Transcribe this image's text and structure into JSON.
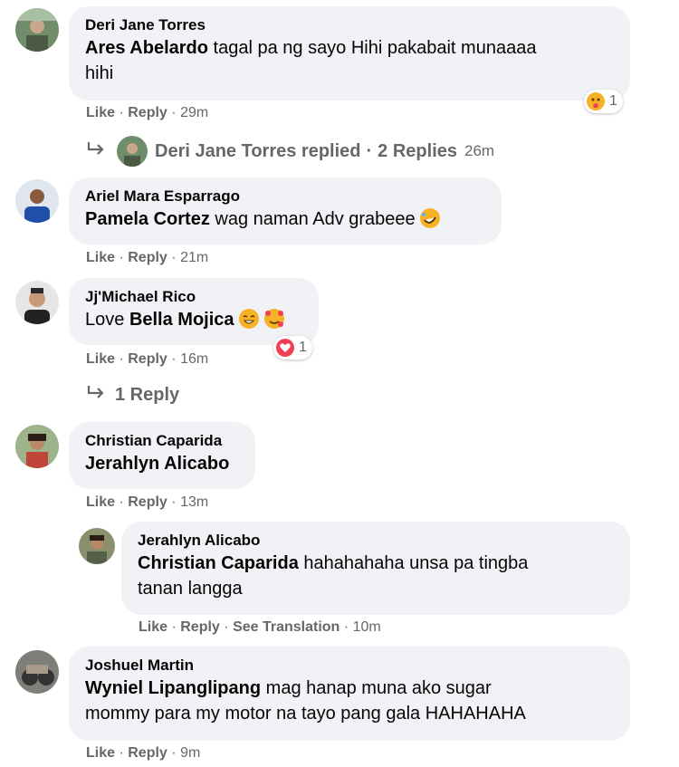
{
  "comments": [
    {
      "author": "Deri Jane Torres",
      "mention": "Ares Abelardo",
      "text_line1": "tagal pa ng sayo Hihi pakabait munaaaa",
      "text_line2": "hihi",
      "like": "Like",
      "reply": "Reply",
      "time": "29m",
      "reaction_icon": "care-icon",
      "reaction_count": "1",
      "replies_author": "Deri Jane Torres replied",
      "replies_count": "2 Replies",
      "replies_time": "26m"
    },
    {
      "author": "Ariel Mara Esparrago",
      "mention": "Pamela Cortez",
      "text": "wag naman Adv grabeee",
      "emoji": "rolling-laughing-emoji",
      "like": "Like",
      "reply": "Reply",
      "time": "21m"
    },
    {
      "author": "Jj'Michael Rico",
      "prefix": "Love",
      "mention": "Bella Mojica",
      "emojis": [
        "grinning-emoji",
        "smiling-hearts-emoji"
      ],
      "like": "Like",
      "reply": "Reply",
      "time": "16m",
      "reaction_icon": "heart-icon",
      "reaction_count": "1",
      "replies_label": "1 Reply"
    },
    {
      "author": "Christian Caparida",
      "mention": "Jerahlyn Alicabo",
      "like": "Like",
      "reply": "Reply",
      "time": "13m",
      "nested_reply": {
        "author": "Jerahlyn Alicabo",
        "mention": "Christian Caparida",
        "text_line1": "hahahahaha unsa pa tingba",
        "text_line2": "tanan langga",
        "like": "Like",
        "reply": "Reply",
        "translate": "See Translation",
        "time": "10m"
      }
    },
    {
      "author": "Joshuel Martin",
      "mention": "Wyniel Lipanglipang",
      "text_line1": "mag hanap muna ako sugar",
      "text_line2": "mommy para my motor na tayo pang gala HAHAHAHA",
      "like": "Like",
      "reply": "Reply",
      "time": "9m"
    }
  ],
  "separator": "·",
  "colors": {
    "bubble": "#f0f2f5",
    "meta": "#65676b",
    "heart": "#f33e58",
    "emoji": "#f7b125"
  }
}
